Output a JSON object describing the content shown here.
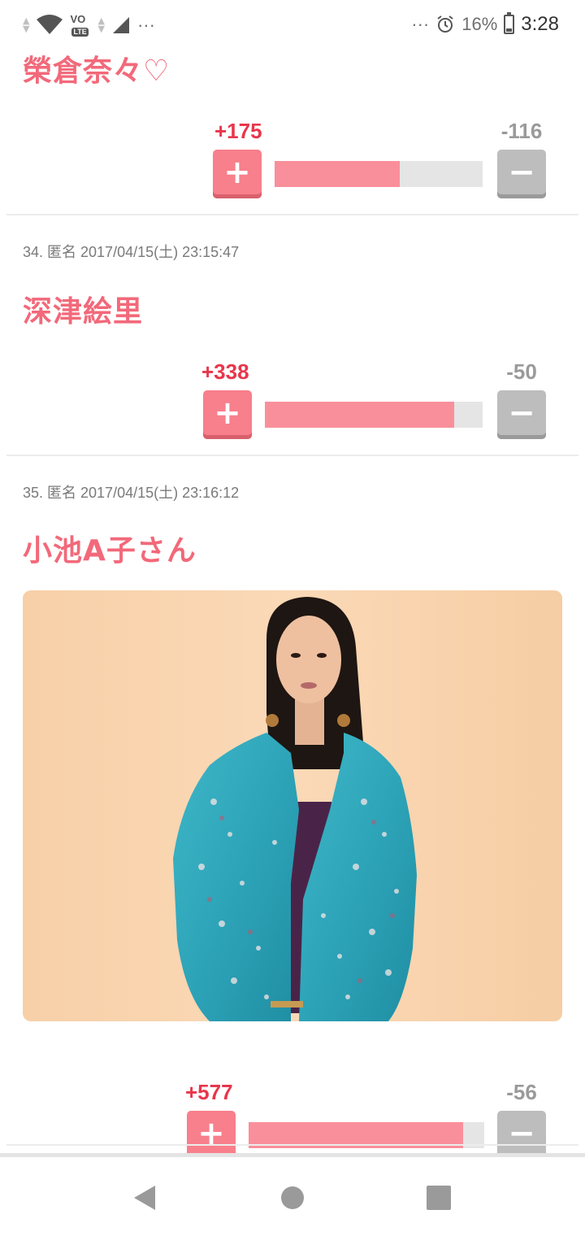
{
  "status_bar": {
    "battery_percent": "16%",
    "time": "3:28",
    "volte_label": "VO",
    "lte_label": "LTE",
    "left_more": "···",
    "right_more": "···"
  },
  "posts": [
    {
      "title": "榮倉奈々♡",
      "plus": "+175",
      "minus": "-116",
      "ratio": 0.601
    },
    {
      "meta": "34. 匿名 2017/04/15(土) 23:15:47",
      "title": "深津絵里",
      "plus": "+338",
      "minus": "-50",
      "ratio": 0.871
    },
    {
      "meta": "35. 匿名 2017/04/15(土) 23:16:12",
      "title": "小池A子さん",
      "plus": "+577",
      "minus": "-56",
      "ratio": 0.912
    }
  ],
  "colors": {
    "title": "#f2697a",
    "plus_count": "#e8364c",
    "plus_button": "#f87f8c",
    "minus_button": "#bdbdbd",
    "bar_fill": "#f98f9a",
    "bar_track": "#e5e5e5"
  },
  "icons": {
    "plus": "plus-icon",
    "minus": "minus-icon",
    "back": "back-triangle-icon",
    "home": "home-circle-icon",
    "recent": "recent-square-icon"
  }
}
